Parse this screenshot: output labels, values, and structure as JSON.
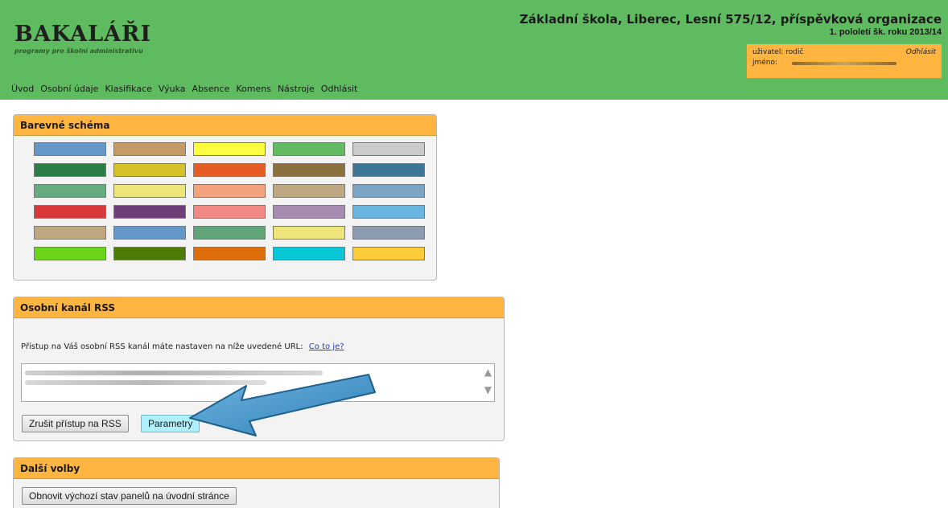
{
  "header": {
    "logo_title": "BAKALÁŘI",
    "logo_subtitle": "programy pro školní administrativu",
    "school_name": "Základní škola, Liberec, Lesní 575/12, příspěvková organizace",
    "school_term": "1. pololetí šk. roku 2013/14",
    "user_label": "uživatel: rodič",
    "name_label": "jméno:",
    "logout_label": "Odhlásit"
  },
  "nav": {
    "items": [
      "Úvod",
      "Osobní údaje",
      "Klasifikace",
      "Výuka",
      "Absence",
      "Komens",
      "Nástroje",
      "Odhlásit"
    ]
  },
  "color_scheme": {
    "title": "Barevné schéma",
    "rows": [
      [
        "#6497c8",
        "#c49a66",
        "#fdfd3f",
        "#62bb62",
        "#cbcbcb"
      ],
      [
        "#2c7c47",
        "#d4c028",
        "#e55c24",
        "#8c7040",
        "#3f7596"
      ],
      [
        "#66aa80",
        "#ede47a",
        "#f2a27c",
        "#bea884",
        "#7ea4c4"
      ],
      [
        "#d8383a",
        "#6f3d78",
        "#f08884",
        "#a58cb0",
        "#6ab4e0"
      ],
      [
        "#bea884",
        "#6497c8",
        "#62a47a",
        "#ede47a",
        "#8c9cb0"
      ],
      [
        "#6ad418",
        "#4e7a08",
        "#dd6e0a",
        "#08c8d8",
        "#fdcd3a"
      ]
    ]
  },
  "rss": {
    "title": "Osobní kanál RSS",
    "description": "Přístup na Váš osobní RSS kanál máte nastaven na níže uvedené URL:",
    "help_link": "Co to je?",
    "cancel_button": "Zrušit přístup na RSS",
    "params_button": "Parametry"
  },
  "more": {
    "title": "Další volby",
    "reset_button": "Obnovit výchozí stav panelů na úvodní stránce"
  },
  "icons": {
    "scroll_up": "▲",
    "scroll_down": "▼"
  }
}
